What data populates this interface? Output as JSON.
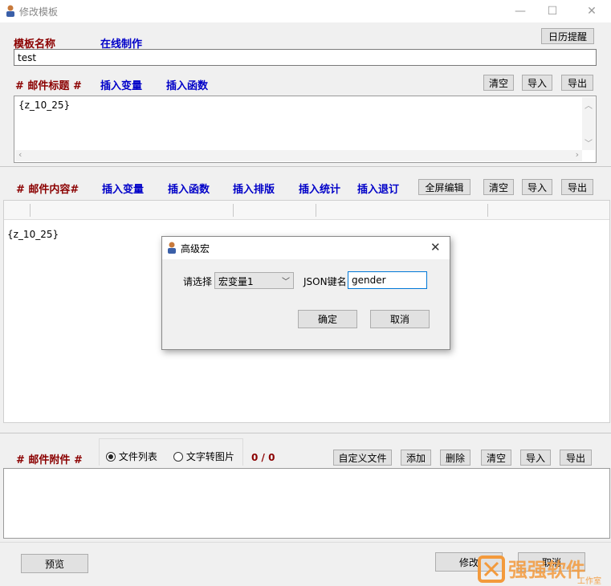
{
  "window": {
    "title": "修改模板"
  },
  "template_name": {
    "label": "模板名称",
    "online_link": "在线制作",
    "value": "test",
    "calendar_button": "日历提醒"
  },
  "subject": {
    "label": "# 邮件标题 #",
    "insert_var": "插入变量",
    "insert_func": "插入函数",
    "clear": "清空",
    "import": "导入",
    "export": "导出",
    "content": "{z_10_25}"
  },
  "body": {
    "label": "# 邮件内容#",
    "insert_var": "插入变量",
    "insert_func": "插入函数",
    "insert_layout": "插入排版",
    "insert_stats": "插入统计",
    "insert_unsub": "插入退订",
    "fullscreen": "全屏编辑",
    "clear": "清空",
    "import": "导入",
    "export": "导出",
    "content": "{z_10_25}"
  },
  "attachment": {
    "label": "# 邮件附件 #",
    "radio_file_list": "文件列表",
    "radio_text_to_image": "文字转图片",
    "count": "0 / 0",
    "custom_file": "自定义文件",
    "add": "添加",
    "delete": "删除",
    "clear": "清空",
    "import": "导入",
    "export": "导出"
  },
  "footer": {
    "preview": "预览",
    "modify": "修改",
    "cancel": "取消"
  },
  "dialog": {
    "title": "高级宏",
    "select_label": "请选择",
    "select_value": "宏变量1",
    "json_key_label": "JSON键名",
    "json_key_value": "gender",
    "ok": "确定",
    "cancel": "取消"
  },
  "watermark": {
    "brand": "强强软件",
    "sub": "工作室"
  },
  "colors": {
    "label_red": "#8b0000",
    "label_blue": "#0000c8",
    "watermark_orange": "#f39a3c"
  }
}
